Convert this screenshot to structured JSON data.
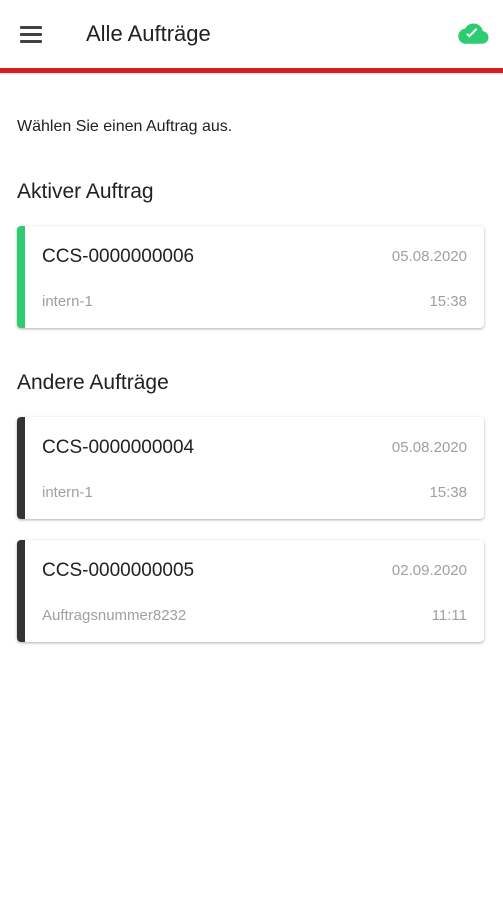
{
  "appbar": {
    "title": "Alle Aufträge",
    "menu_icon": "hamburger-menu-icon",
    "sync_icon": "cloud-done-icon",
    "accent_line_color": "#d32020",
    "sync_icon_color": "#2ecc71"
  },
  "main": {
    "prompt": "Wählen Sie einen Auftrag aus.",
    "active_section": {
      "title": "Aktiver Auftrag",
      "status_color": "#2ecc71",
      "orders": [
        {
          "id": "CCS-0000000006",
          "date": "05.08.2020",
          "subtitle": "intern-1",
          "time": "15:38"
        }
      ]
    },
    "other_section": {
      "title": "Andere Aufträge",
      "status_color": "#333333",
      "orders": [
        {
          "id": "CCS-0000000004",
          "date": "05.08.2020",
          "subtitle": "intern-1",
          "time": "15:38"
        },
        {
          "id": "CCS-0000000005",
          "date": "02.09.2020",
          "subtitle": "Auftragsnummer8232",
          "time": "11:11"
        }
      ]
    }
  }
}
